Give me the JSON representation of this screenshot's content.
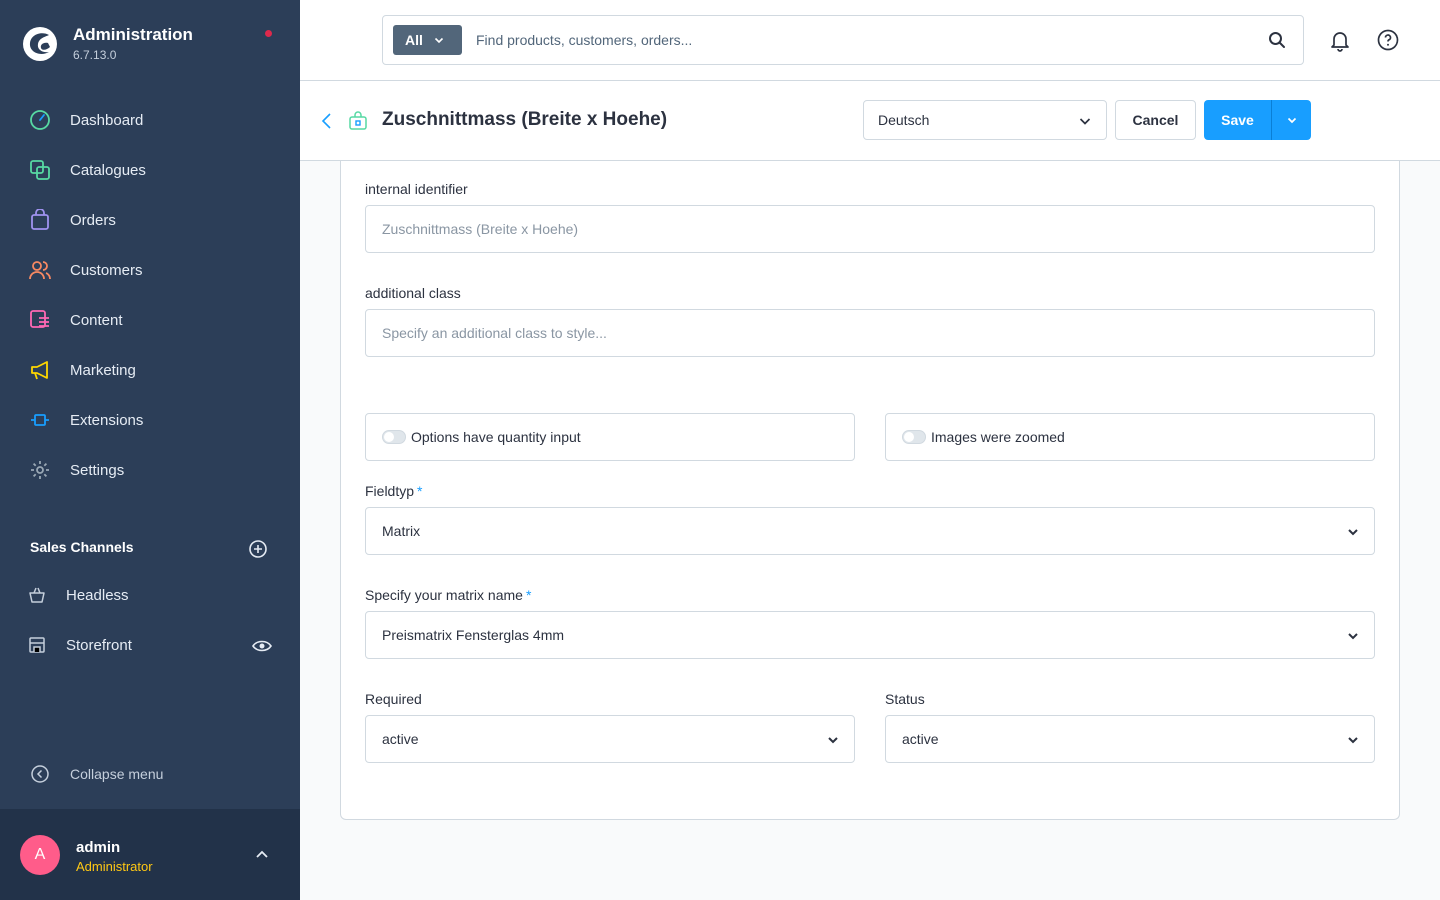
{
  "app": {
    "title": "Administration",
    "version": "6.7.13.0"
  },
  "sidebar": {
    "nav": [
      {
        "label": "Dashboard",
        "icon": "dashboard-icon",
        "color": "#57d9a3"
      },
      {
        "label": "Catalogues",
        "icon": "catalogue-icon",
        "color": "#57d9a3"
      },
      {
        "label": "Orders",
        "icon": "orders-icon",
        "color": "#a092f0"
      },
      {
        "label": "Customers",
        "icon": "customers-icon",
        "color": "#f88962"
      },
      {
        "label": "Content",
        "icon": "content-icon",
        "color": "#ff68b4"
      },
      {
        "label": "Marketing",
        "icon": "marketing-icon",
        "color": "#ffd700"
      },
      {
        "label": "Extensions",
        "icon": "extensions-icon",
        "color": "#189eff"
      },
      {
        "label": "Settings",
        "icon": "settings-icon",
        "color": "#9aa8b5"
      }
    ],
    "sales_channels_title": "Sales Channels",
    "sales_channels": [
      {
        "label": "Headless",
        "icon": "basket-icon"
      },
      {
        "label": "Storefront",
        "icon": "storefront-icon"
      }
    ],
    "collapse_label": "Collapse menu",
    "user": {
      "initial": "A",
      "name": "admin",
      "role": "Administrator"
    }
  },
  "search": {
    "type_label": "All",
    "placeholder": "Find products, customers, orders..."
  },
  "smartbar": {
    "title": "Zuschnittmass (Breite x Hoehe)",
    "language": "Deutsch",
    "cancel_label": "Cancel",
    "save_label": "Save"
  },
  "form": {
    "internal_identifier": {
      "label": "internal identifier",
      "placeholder": "Zuschnittmass (Breite x Hoehe)"
    },
    "additional_class": {
      "label": "additional class",
      "placeholder": "Specify an additional class to style..."
    },
    "toggles": [
      {
        "label": "Options have quantity input",
        "on": false
      },
      {
        "label": "Images were zoomed",
        "on": false
      }
    ],
    "fieldtyp": {
      "label": "Fieldtyp",
      "required_mark": "*",
      "value": "Matrix"
    },
    "matrix_name": {
      "label": "Specify your matrix name",
      "required_mark": "*",
      "value": "Preismatrix Fensterglas 4mm"
    },
    "required": {
      "label": "Required",
      "value": "active"
    },
    "status": {
      "label": "Status",
      "value": "active"
    }
  },
  "colors": {
    "sidebar_bg": "#2c3e58",
    "accent": "#189eff",
    "notification_dot": "#de294c",
    "avatar": "#ff5c8a",
    "role_text": "#ffc814"
  }
}
